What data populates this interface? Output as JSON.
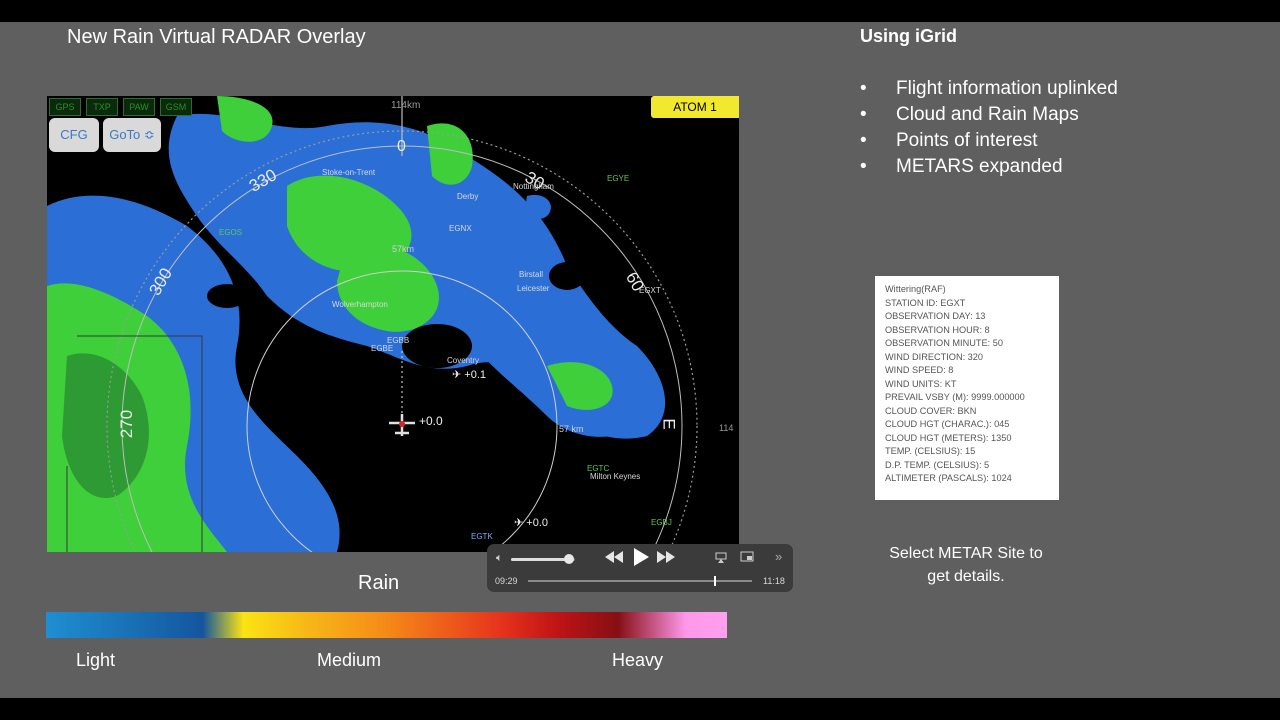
{
  "slide": {
    "title": "New Rain Virtual RADAR Overlay",
    "right_title": "Using iGrid",
    "bullets": [
      "Flight information uplinked",
      "Cloud and Rain Maps",
      "Points of interest",
      "METARS expanded"
    ],
    "select_note_line1": "Select METAR Site to",
    "select_note_line2": "get details."
  },
  "radar": {
    "status_buttons": [
      "GPS",
      "TXP",
      "PAW",
      "GSM"
    ],
    "cfg_label": "CFG",
    "goto_label": "GoTo ≎",
    "atom_label": "ATOM 1",
    "range_top": "114km",
    "range_right": "114",
    "ring_inner": "57km",
    "ring_inner2": "57 km",
    "compass": [
      "0",
      "30",
      "60",
      "300",
      "330",
      "270"
    ],
    "heading_mark": "E",
    "places": [
      "Stoke-on-Trent",
      "Derby",
      "Nottingham",
      "Birstall",
      "Leicester",
      "Wolverhampton",
      "Coventry",
      "Milton Keynes"
    ],
    "airports": [
      "EGOS",
      "EGNX",
      "EGYE",
      "EGXT",
      "EGBE",
      "EGTC",
      "EGTK",
      "EGBJ",
      "EGBB"
    ],
    "traffic": [
      "+0.1",
      "+0.0",
      "+0.0"
    ]
  },
  "metar": {
    "lines": [
      "Wittering(RAF)",
      "STATION ID: EGXT",
      "OBSERVATION DAY: 13",
      "OBSERVATION HOUR: 8",
      "OBSERVATION MINUTE: 50",
      "WIND DIRECTION: 320",
      "WIND SPEED: 8",
      "WIND UNITS: KT",
      "PREVAIL VSBY (M): 9999.000000",
      "CLOUD COVER: BKN",
      "CLOUD HGT (CHARAC.): 045",
      "CLOUD HGT (METERS): 1350",
      "TEMP. (CELSIUS): 15",
      "D.P. TEMP. (CELSIUS): 5",
      "ALTIMETER (PASCALS): 1024"
    ]
  },
  "legend": {
    "title": "Rain",
    "light": "Light",
    "medium": "Medium",
    "heavy": "Heavy"
  },
  "player": {
    "elapsed": "09:29",
    "remaining": "11:18",
    "volume_fraction": 0.9,
    "progress_fraction": 0.83
  },
  "colors": {
    "slide_bg": "#5f5f5f",
    "rain_green": "#3fcf3a",
    "rain_blue": "#2b6fd6",
    "atom_yellow": "#f2e82e"
  },
  "icons": {
    "volume": "speaker-icon",
    "rewind": "rewind-icon",
    "play": "play-icon",
    "forward": "fast-forward-icon",
    "airplay": "airplay-icon",
    "pip": "picture-in-picture-icon",
    "more": "chevron-right-icon"
  }
}
